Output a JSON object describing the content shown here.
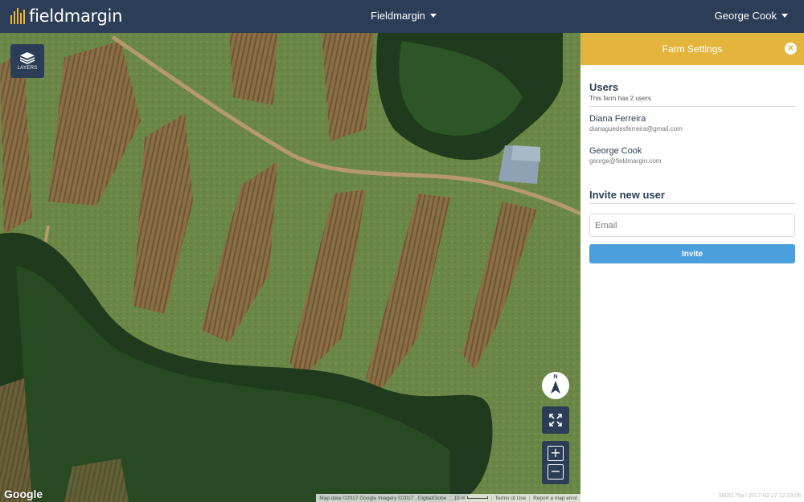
{
  "header": {
    "brand": "fieldmargin",
    "farm_switcher": "Fieldmargin",
    "user_menu": "George Cook"
  },
  "map": {
    "layers_label": "LAYERS",
    "compass_label": "N",
    "zoom_in": "+",
    "zoom_out": "−",
    "google_logo": "Google",
    "attribution": {
      "map_data": "Map data ©2017 Google Imagery ©2017 , DigitalGlobe",
      "scale": "10 m",
      "terms": "Terms of Use",
      "report": "Report a map error"
    }
  },
  "panel": {
    "title": "Farm Settings",
    "close_icon": "close-icon",
    "users_title": "Users",
    "users_count_text": "This farm has 2 users",
    "users": [
      {
        "name": "Diana Ferreira",
        "email": "dianaguedesferreira@gmail.com"
      },
      {
        "name": "George Cook",
        "email": "george@fieldmargin.com"
      }
    ],
    "invite_title": "Invite new user",
    "email_placeholder": "Email",
    "invite_button": "Invite",
    "footer_meta": "5805175a / 2017-02-27 12:23:08"
  },
  "colors": {
    "topbar": "#2c3e57",
    "panel_header": "#e4b53c",
    "invite_button": "#4a9fdc",
    "brand_accent": "#f0b429"
  }
}
